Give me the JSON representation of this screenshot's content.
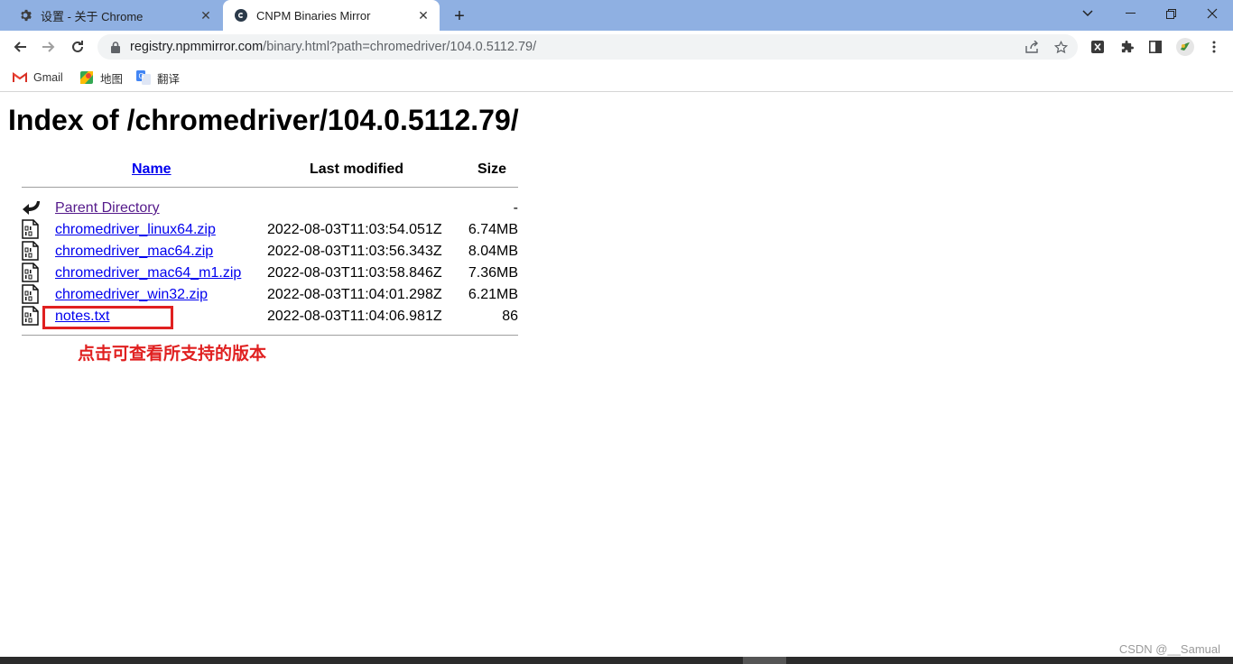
{
  "browser": {
    "tabs": [
      {
        "title": "设置 - 关于 Chrome",
        "icon": "gear-icon",
        "active": false
      },
      {
        "title": "CNPM Binaries Mirror",
        "icon": "cnpm-logo-icon",
        "active": true
      }
    ],
    "url_host": "registry.npmmirror.com",
    "url_rest": "/binary.html?path=chromedriver/104.0.5112.79/",
    "bookmarks": [
      {
        "label": "Gmail",
        "icon": "gmail-icon"
      },
      {
        "label": "地图",
        "icon": "maps-icon"
      },
      {
        "label": "翻译",
        "icon": "translate-icon"
      }
    ]
  },
  "page": {
    "heading": "Index of /chromedriver/104.0.5112.79/",
    "columns": {
      "name": "Name",
      "modified": "Last modified",
      "size": "Size"
    },
    "rows": [
      {
        "name": "Parent Directory",
        "modified": "",
        "size": "-",
        "icon": "back-arrow-icon"
      },
      {
        "name": "chromedriver_linux64.zip",
        "modified": "2022-08-03T11:03:54.051Z",
        "size": "6.74MB",
        "icon": "binary-file-icon"
      },
      {
        "name": "chromedriver_mac64.zip",
        "modified": "2022-08-03T11:03:56.343Z",
        "size": "8.04MB",
        "icon": "binary-file-icon"
      },
      {
        "name": "chromedriver_mac64_m1.zip",
        "modified": "2022-08-03T11:03:58.846Z",
        "size": "7.36MB",
        "icon": "binary-file-icon"
      },
      {
        "name": "chromedriver_win32.zip",
        "modified": "2022-08-03T11:04:01.298Z",
        "size": "6.21MB",
        "icon": "binary-file-icon"
      },
      {
        "name": "notes.txt",
        "modified": "2022-08-03T11:04:06.981Z",
        "size": "86",
        "icon": "binary-file-icon"
      }
    ],
    "annotation": "点击可查看所支持的版本",
    "annotation_color": "#e02020"
  },
  "watermark": "CSDN @__Samual"
}
